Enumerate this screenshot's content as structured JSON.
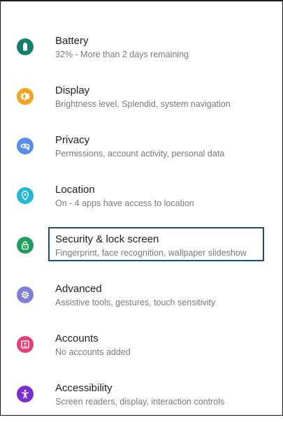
{
  "settings": {
    "items": [
      {
        "title": "Battery",
        "subtitle": "32% - More than 2 days remaining",
        "icon": "battery-icon",
        "color": "#157f6e"
      },
      {
        "title": "Display",
        "subtitle": "Brightness level, Splendid, system navigation",
        "icon": "brightness-icon",
        "color": "#f4a31c"
      },
      {
        "title": "Privacy",
        "subtitle": "Permissions, account activity, personal data",
        "icon": "privacy-eye-icon",
        "color": "#5b8def"
      },
      {
        "title": "Location",
        "subtitle": "On - 4 apps have access to location",
        "icon": "location-pin-icon",
        "color": "#22b8d6"
      },
      {
        "title": "Security & lock screen",
        "subtitle": "Fingerprint, face recognition, wallpaper slideshow",
        "icon": "lock-icon",
        "color": "#1e9e57",
        "focused": true
      },
      {
        "title": "Advanced",
        "subtitle": "Assistive tools, gestures, touch sensitivity",
        "icon": "gear-icon",
        "color": "#7f7fd8"
      },
      {
        "title": "Accounts",
        "subtitle": "No accounts added",
        "icon": "account-card-icon",
        "color": "#e83e74"
      },
      {
        "title": "Accessibility",
        "subtitle": "Screen readers, display, interaction controls",
        "icon": "accessibility-icon",
        "color": "#7b2fd3"
      }
    ]
  }
}
